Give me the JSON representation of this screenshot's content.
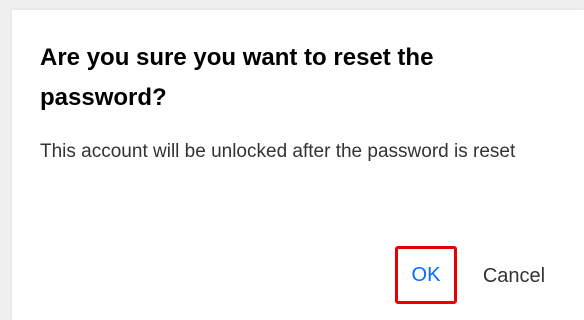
{
  "dialog": {
    "title": "Are you sure you want to reset the password?",
    "message": "This account will be unlocked after the password is reset",
    "ok_label": "OK",
    "cancel_label": "Cancel"
  },
  "colors": {
    "ok_text": "#006eff",
    "highlight_border": "#e60000",
    "title_text": "#000000",
    "message_text": "#333333"
  }
}
